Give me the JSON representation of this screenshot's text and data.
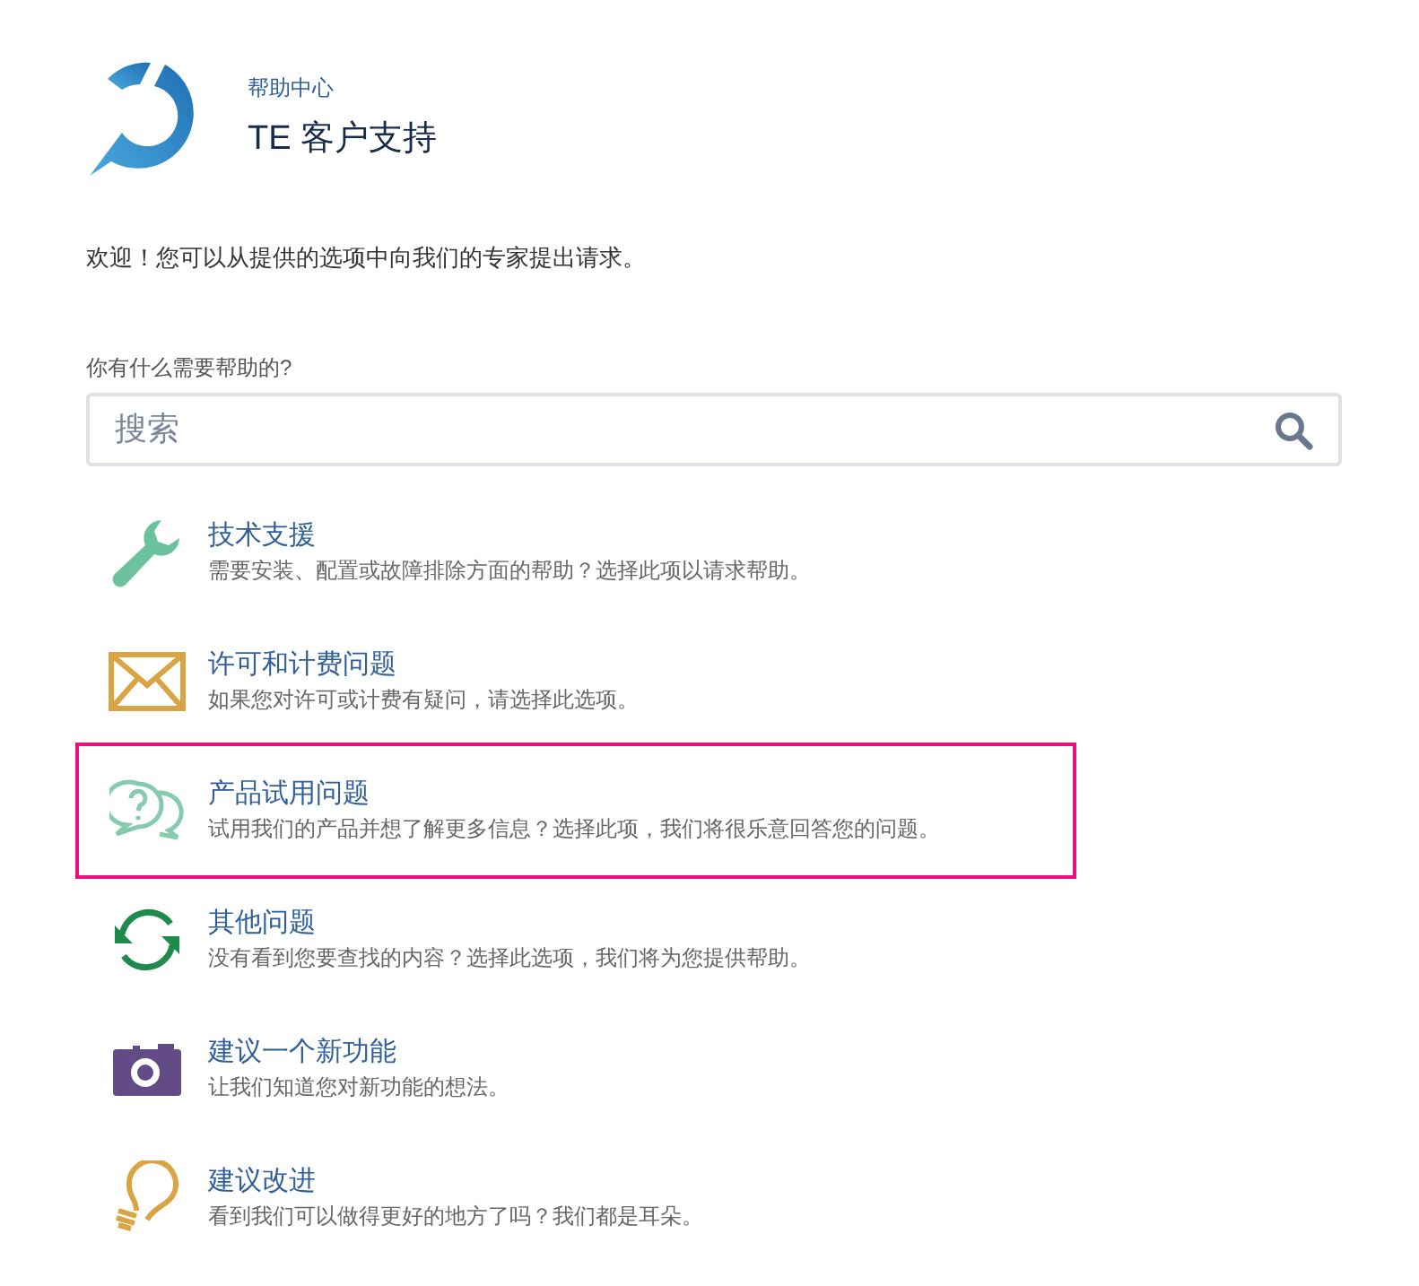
{
  "header": {
    "subtitle": "帮助中心",
    "title": "TE 客户支持"
  },
  "welcome": "欢迎！您可以从提供的选项中向我们的专家提出请求。",
  "search": {
    "label": "你有什么需要帮助的?",
    "placeholder": "搜索"
  },
  "options": [
    {
      "kind": "wrench",
      "title": "技术支援",
      "description": "需要安装、配置或故障排除方面的帮助？选择此项以请求帮助。",
      "selected": false
    },
    {
      "kind": "envelope",
      "title": "许可和计费问题",
      "description": "如果您对许可或计费有疑问，请选择此选项。",
      "selected": false
    },
    {
      "kind": "chat",
      "title": "产品试用问题",
      "description": "试用我们的产品并想了解更多信息？选择此项，我们将很乐意回答您的问题。",
      "selected": true
    },
    {
      "kind": "refresh",
      "title": "其他问题",
      "description": "没有看到您要查找的内容？选择此选项，我们将为您提供帮助。",
      "selected": false
    },
    {
      "kind": "camera",
      "title": "建议一个新功能",
      "description": "让我们知道您对新功能的想法。",
      "selected": false
    },
    {
      "kind": "bulb",
      "title": "建议改进",
      "description": "看到我们可以做得更好的地方了吗？我们都是耳朵。",
      "selected": false
    }
  ]
}
